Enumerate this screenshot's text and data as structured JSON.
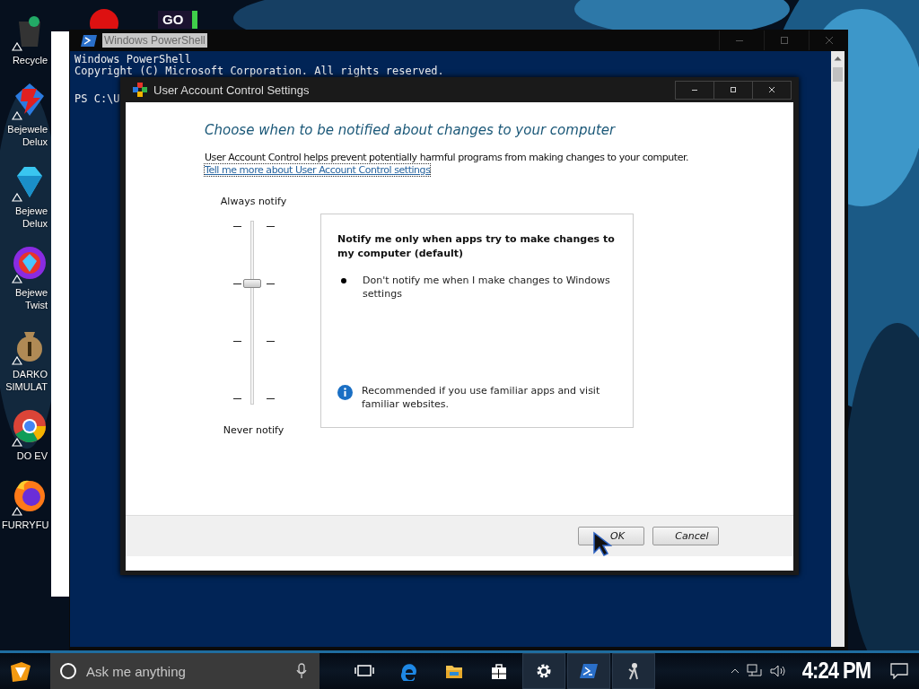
{
  "desktop": {
    "top_icons": [
      {
        "kind": "red-ball"
      },
      {
        "kind": "go",
        "badge": "GO"
      }
    ],
    "icons": [
      {
        "kind": "recycle",
        "label": "Recycle"
      },
      {
        "kind": "gem2",
        "label": "Bejewele Delux"
      },
      {
        "kind": "diamond",
        "label": "Bejewe Delux"
      },
      {
        "kind": "orb",
        "label": "Bejewe Twist"
      },
      {
        "kind": "moneybag",
        "label": "DARKO SIMULAT"
      },
      {
        "kind": "chrome",
        "label": "DO EV"
      },
      {
        "kind": "firefox",
        "label": "FURRYFU"
      }
    ]
  },
  "powershell": {
    "title": "Windows PowerShell",
    "title_selected": true,
    "lines": [
      "Windows PowerShell",
      "Copyright (C) Microsoft Corporation. All rights reserved."
    ],
    "prompt": "PS C:\\U"
  },
  "uac": {
    "title": "User Account Control Settings",
    "heading": "Choose when to be notified about changes to your computer",
    "description": "User Account Control helps prevent potentially harmful programs from making changes to your computer.",
    "link": "Tell me more about User Account Control settings",
    "slider": {
      "top_label": "Always notify",
      "bottom_label": "Never notify",
      "level": 0.667
    },
    "panel": {
      "title": "Notify me only when apps try to make changes to my computer (default)",
      "bullets": [
        "Don't notify me when I make changes to Windows settings"
      ],
      "note": "Recommended if you use familiar apps and visit familiar websites."
    },
    "buttons": [
      {
        "label": "OK"
      },
      {
        "label": "Cancel"
      }
    ]
  },
  "taskbar": {
    "search": {
      "placeholder": "Ask me anything"
    },
    "apps": [
      {
        "kind": "taskview",
        "active": false
      },
      {
        "kind": "edge",
        "active": false
      },
      {
        "kind": "explorer",
        "active": false
      },
      {
        "kind": "store",
        "active": false
      },
      {
        "kind": "settings",
        "active": true
      },
      {
        "kind": "powershell",
        "active": true
      },
      {
        "kind": "figure",
        "active": true
      }
    ],
    "clock": "4:24 PM"
  }
}
